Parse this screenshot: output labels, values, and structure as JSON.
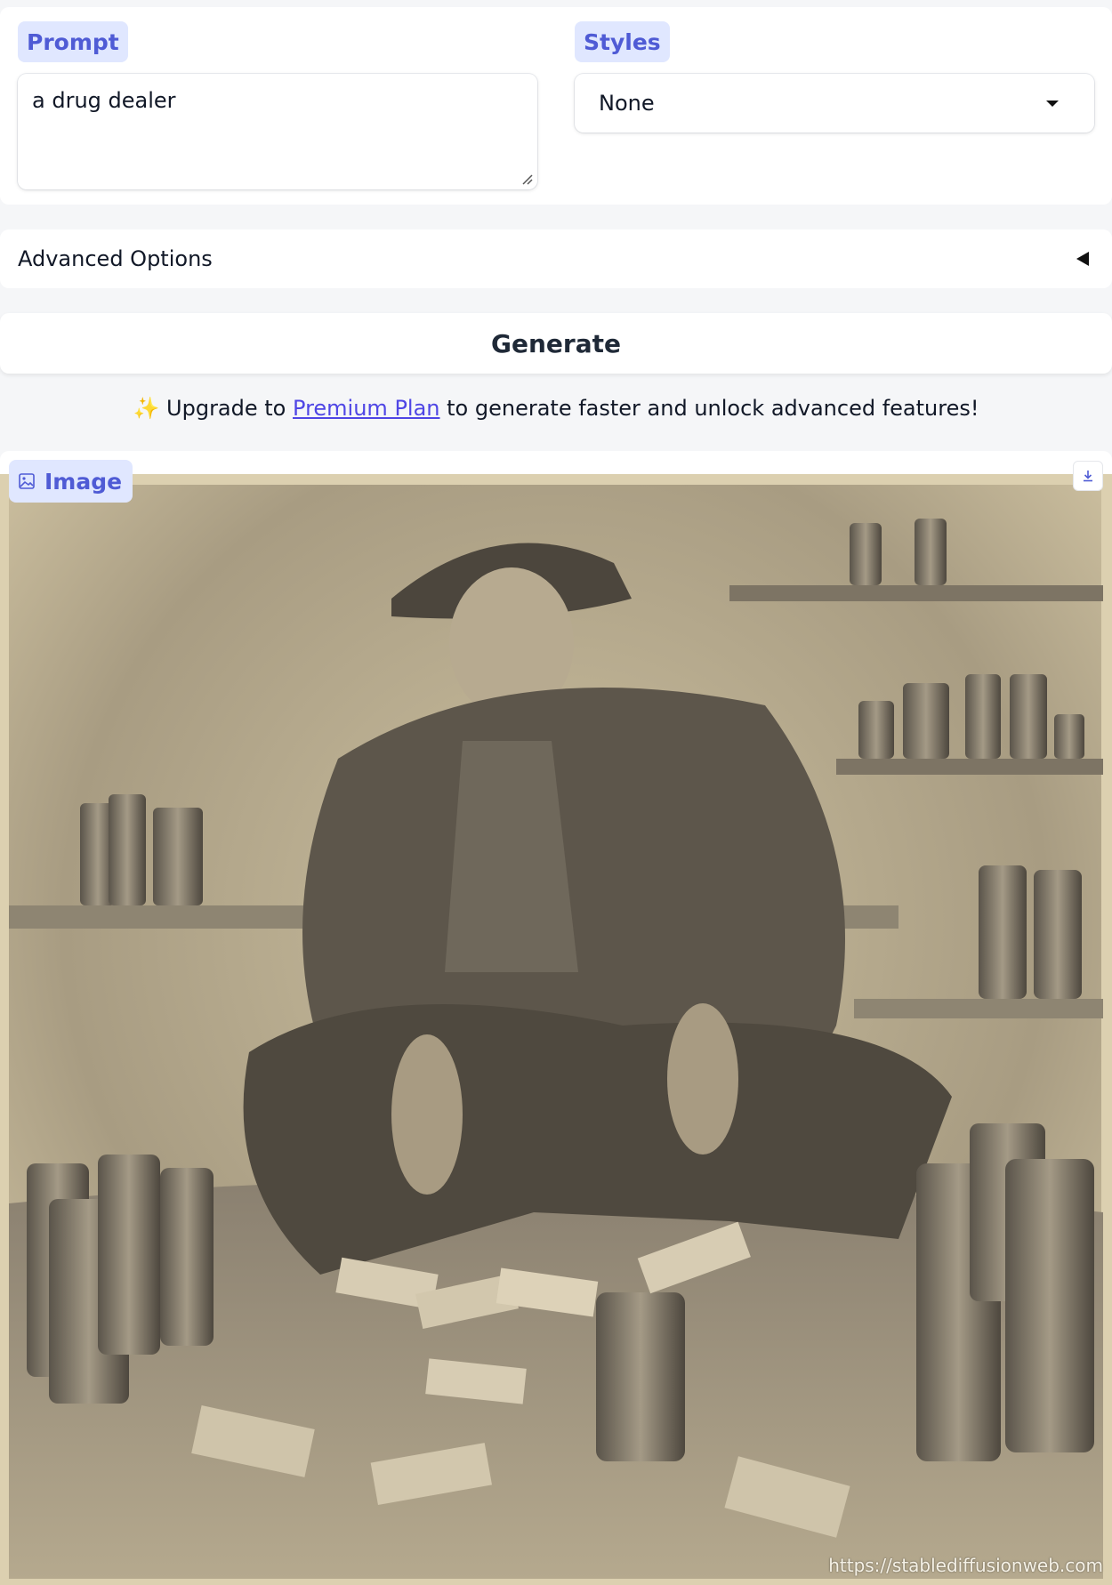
{
  "prompt": {
    "label": "Prompt",
    "value": "a drug dealer"
  },
  "styles": {
    "label": "Styles",
    "selected": "None"
  },
  "advanced_options": {
    "label": "Advanced Options"
  },
  "generate": {
    "label": "Generate"
  },
  "promo": {
    "sparkle": "✨",
    "prefix": "Upgrade to",
    "link": "Premium Plan",
    "suffix": "to generate faster and unlock advanced features!"
  },
  "image": {
    "label": "Image",
    "watermark": "https://stablediffusionweb.com"
  },
  "icons": [
    "image-icon",
    "download-icon",
    "chevron-down-icon",
    "collapse-arrow-icon",
    "resize-handle-icon"
  ],
  "colors": {
    "accent": "#4f5bd5",
    "label_bg": "#e0e7ff",
    "sepia_bg": "#d9cdb0"
  }
}
